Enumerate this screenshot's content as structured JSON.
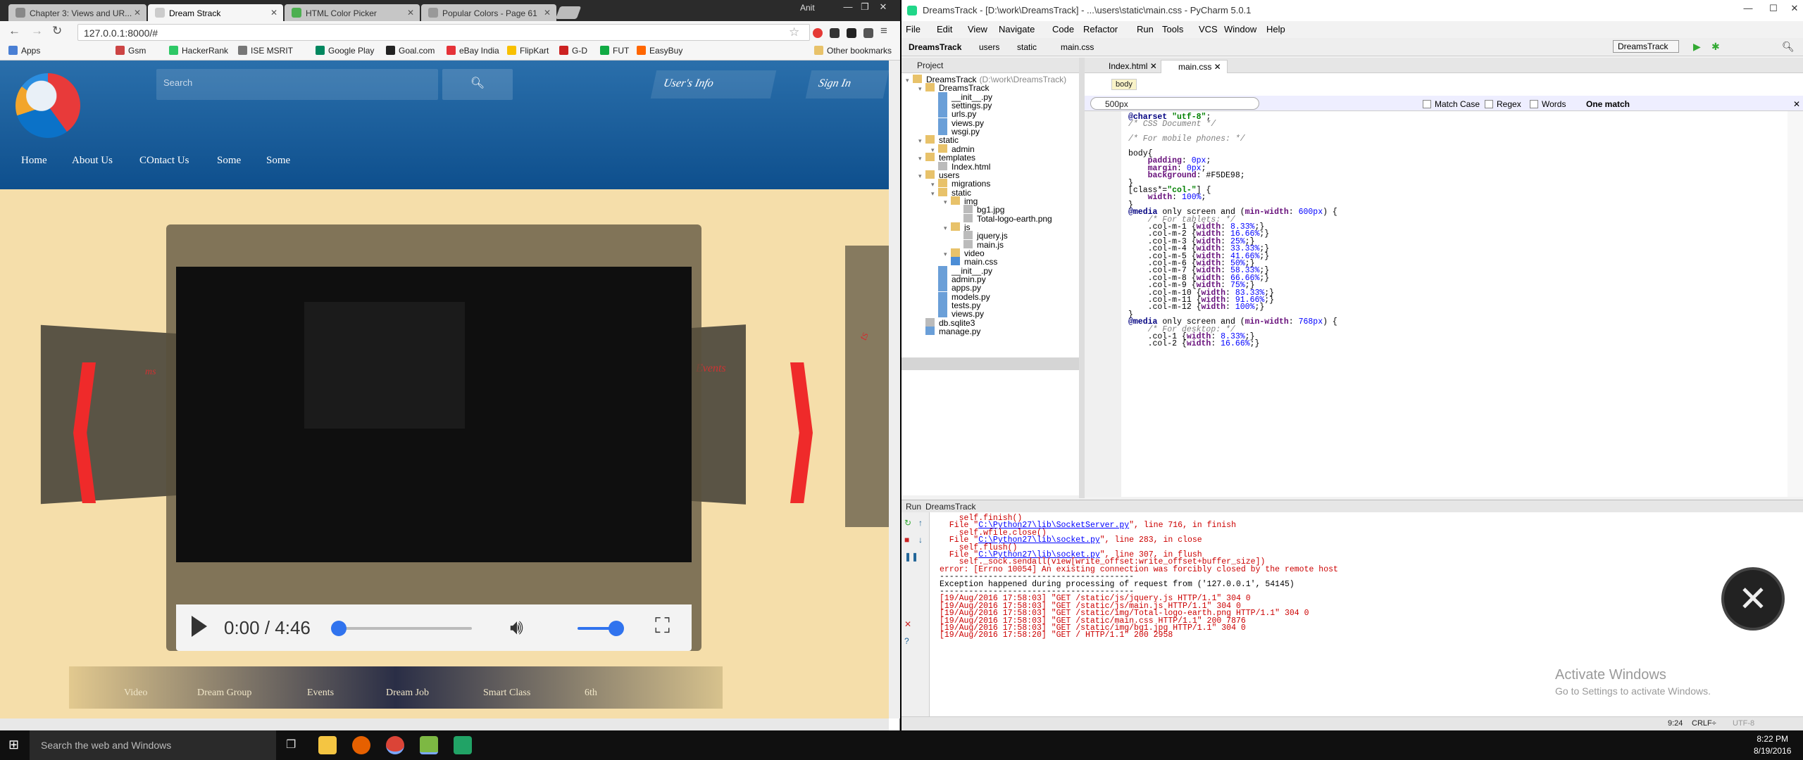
{
  "chrome": {
    "tabs": [
      {
        "label": "Chapter 3: Views and UR..."
      },
      {
        "label": "Dream Strack"
      },
      {
        "label": "HTML Color Picker"
      },
      {
        "label": "Popular Colors - Page 61"
      }
    ],
    "user": "Anit",
    "url": "127.0.0.1:8000/#",
    "bookmarks": [
      {
        "label": "Apps"
      },
      {
        "label": "Gsm"
      },
      {
        "label": "HackerRank"
      },
      {
        "label": "ISE MSRIT"
      },
      {
        "label": "Google Play"
      },
      {
        "label": "Goal.com"
      },
      {
        "label": "eBay India"
      },
      {
        "label": "FlipKart"
      },
      {
        "label": "G-D"
      },
      {
        "label": "FUT"
      },
      {
        "label": "EasyBuy"
      },
      {
        "label": "Other bookmarks"
      }
    ]
  },
  "site": {
    "search_placeholder": "Search",
    "users_info": "User's Info",
    "sign_in": "Sign In",
    "nav": [
      {
        "label": "Home"
      },
      {
        "label": "About Us"
      },
      {
        "label": "COntact Us"
      },
      {
        "label": "Some"
      },
      {
        "label": "Some"
      }
    ],
    "card_left": "ms",
    "card_right": "Events",
    "card_far": "ts",
    "video": {
      "time": "0:00 / 4:46",
      "progress": 0,
      "volume": 1.0
    },
    "bottom_nav": [
      {
        "label": "Video"
      },
      {
        "label": "Dream Group"
      },
      {
        "label": "Events"
      },
      {
        "label": "Dream Job"
      },
      {
        "label": "Smart Class"
      },
      {
        "label": "6th"
      }
    ]
  },
  "pycharm": {
    "title": "DreamsTrack - [D:\\work\\DreamsTrack] - ...\\users\\static\\main.css - PyCharm 5.0.1",
    "menu": [
      "File",
      "Edit",
      "View",
      "Navigate",
      "Code",
      "Refactor",
      "Run",
      "Tools",
      "VCS",
      "Window",
      "Help"
    ],
    "breadcrumbs": [
      "DreamsTrack",
      "users",
      "static",
      "main.css"
    ],
    "run_config": "DreamsTrack",
    "project_label": "Project",
    "tree": [
      {
        "label": "DreamsTrack",
        "note": "(D:\\work\\DreamsTrack)",
        "d": 0
      },
      {
        "label": "DreamsTrack",
        "d": 1
      },
      {
        "label": "__init__.py",
        "d": 2
      },
      {
        "label": "settings.py",
        "d": 2
      },
      {
        "label": "urls.py",
        "d": 2
      },
      {
        "label": "views.py",
        "d": 2
      },
      {
        "label": "wsgi.py",
        "d": 2
      },
      {
        "label": "static",
        "d": 1
      },
      {
        "label": "admin",
        "d": 2
      },
      {
        "label": "templates",
        "d": 1
      },
      {
        "label": "Index.html",
        "d": 2
      },
      {
        "label": "users",
        "d": 1
      },
      {
        "label": "migrations",
        "d": 2
      },
      {
        "label": "static",
        "d": 2
      },
      {
        "label": "img",
        "d": 3
      },
      {
        "label": "bg1.jpg",
        "d": 4
      },
      {
        "label": "Total-logo-earth.png",
        "d": 4
      },
      {
        "label": "js",
        "d": 3
      },
      {
        "label": "jquery.js",
        "d": 4
      },
      {
        "label": "main.js",
        "d": 4
      },
      {
        "label": "video",
        "d": 3
      },
      {
        "label": "main.css",
        "d": 3
      },
      {
        "label": "__init__.py",
        "d": 2
      },
      {
        "label": "admin.py",
        "d": 2
      },
      {
        "label": "apps.py",
        "d": 2
      },
      {
        "label": "models.py",
        "d": 2
      },
      {
        "label": "tests.py",
        "d": 2
      },
      {
        "label": "views.py",
        "d": 2
      },
      {
        "label": "db.sqlite3",
        "d": 1
      },
      {
        "label": "manage.py",
        "d": 1
      }
    ],
    "editor_tabs": [
      "Index.html",
      "main.css"
    ],
    "body_tooltip": "body",
    "find": {
      "query": "500px",
      "match_case": "Match Case",
      "regex": "Regex",
      "words": "Words",
      "result": "One match"
    },
    "code": [
      "@charset \"utf-8\";",
      "/* CSS Document */",
      "",
      "/* For mobile phones: */",
      "",
      "body{",
      "    padding: 0px;",
      "    margin: 0px;",
      "    background: #F5DE98;",
      "}",
      "[class*=\"col-\"] {",
      "    width: 100%;",
      "}",
      "@media only screen and (min-width: 600px) {",
      "    /* For tablets: */",
      "    .col-m-1 {width: 8.33%;}",
      "    .col-m-2 {width: 16.66%;}",
      "    .col-m-3 {width: 25%;}",
      "    .col-m-4 {width: 33.33%;}",
      "    .col-m-5 {width: 41.66%;}",
      "    .col-m-6 {width: 50%;}",
      "    .col-m-7 {width: 58.33%;}",
      "    .col-m-8 {width: 66.66%;}",
      "    .col-m-9 {width: 75%;}",
      "    .col-m-10 {width: 83.33%;}",
      "    .col-m-11 {width: 91.66%;}",
      "    .col-m-12 {width: 100%;}",
      "}",
      "@media only screen and (min-width: 768px) {",
      "    /* For desktop: */",
      "    .col-1 {width: 8.33%;}",
      "    .col-2 {width: 16.66%;}"
    ],
    "run_label": "Run",
    "run_name": "DreamsTrack",
    "console": [
      {
        "t": "    self.finish()"
      },
      {
        "t": "  File \"",
        "link": "C:\\Python27\\lib\\SocketServer.py",
        "after": "\", line 716, in finish"
      },
      {
        "t": "    self.wfile.close()"
      },
      {
        "t": "  File \"",
        "link": "C:\\Python27\\lib\\socket.py",
        "after": "\", line 283, in close"
      },
      {
        "t": "    self.flush()"
      },
      {
        "t": "  File \"",
        "link": "C:\\Python27\\lib\\socket.py",
        "after": "\", line 307, in flush"
      },
      {
        "t": "    self._sock.sendall(view[write_offset:write_offset+buffer_size])"
      },
      {
        "t": "error: [Errno 10054] An existing connection was forcibly closed by the remote host"
      },
      {
        "t": "----------------------------------------",
        "blk": true
      },
      {
        "t": "Exception happened during processing of request from ('127.0.0.1', 54145)",
        "blk": true
      },
      {
        "t": "----------------------------------------",
        "blk": true
      },
      {
        "t": "[19/Aug/2016 17:58:03] \"GET /static/js/jquery.js HTTP/1.1\" 304 0"
      },
      {
        "t": "[19/Aug/2016 17:58:03] \"GET /static/js/main.js HTTP/1.1\" 304 0"
      },
      {
        "t": "[19/Aug/2016 17:58:03] \"GET /static/img/Total-logo-earth.png HTTP/1.1\" 304 0"
      },
      {
        "t": "[19/Aug/2016 17:58:03] \"GET /static/main.css HTTP/1.1\" 200 7876"
      },
      {
        "t": "[19/Aug/2016 17:58:03] \"GET /static/img/bg1.jpg HTTP/1.1\" 304 0"
      },
      {
        "t": "[19/Aug/2016 17:58:20] \"GET / HTTP/1.1\" 200 2958"
      }
    ],
    "status": {
      "pos": "9:24",
      "eol": "CRLF÷",
      "enc": "UTF-8"
    },
    "activate_title": "Activate Windows",
    "activate_sub": "Go to Settings to activate Windows."
  },
  "taskbar": {
    "search": "Search the web and Windows",
    "time": "8:22 PM",
    "date": "8/19/2016"
  }
}
